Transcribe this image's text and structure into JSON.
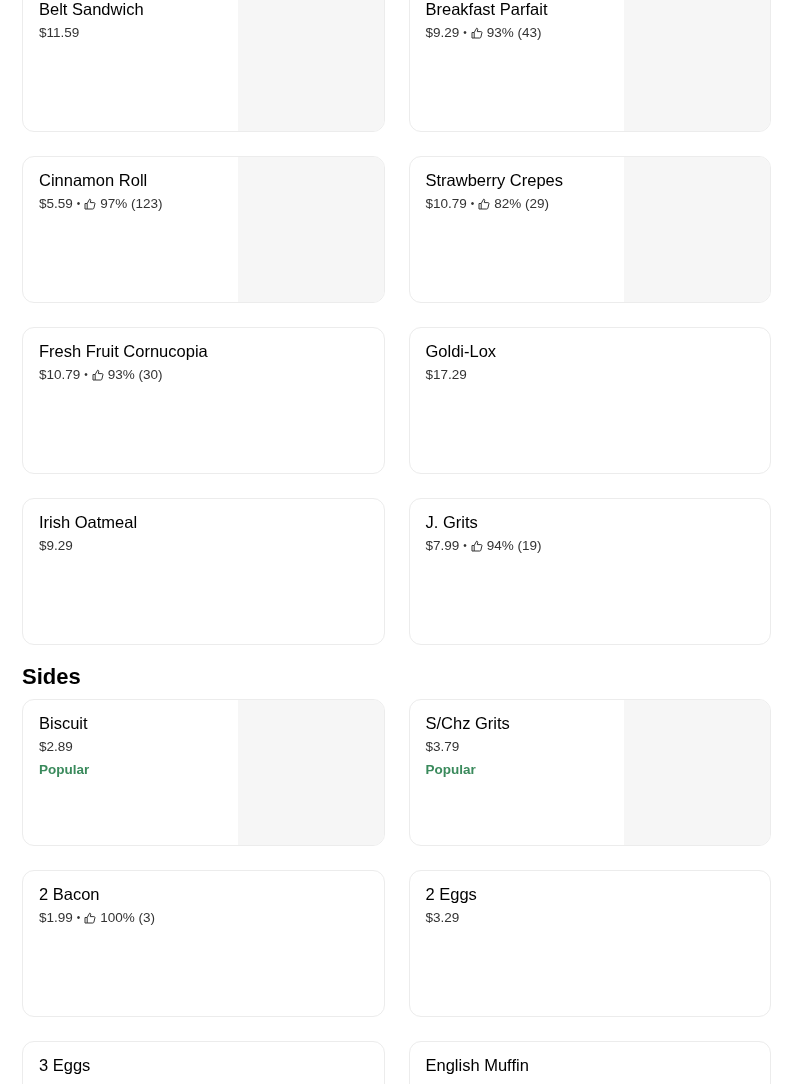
{
  "sections": [
    {
      "items": [
        {
          "name": "Belt Sandwich",
          "price": "$11.59",
          "has_image": true
        },
        {
          "name": "Breakfast Parfait",
          "price": "$9.29",
          "separator": "•",
          "rating": "93% (43)",
          "has_image": true
        },
        {
          "name": "Cinnamon Roll",
          "price": "$5.59",
          "separator": "•",
          "rating": "97% (123)",
          "has_image": true
        },
        {
          "name": "Strawberry Crepes",
          "price": "$10.79",
          "separator": "•",
          "rating": "82% (29)",
          "has_image": true
        },
        {
          "name": "Fresh Fruit Cornucopia",
          "price": "$10.79",
          "separator": "•",
          "rating": "93% (30)",
          "has_image": false
        },
        {
          "name": "Goldi-Lox",
          "price": "$17.29",
          "has_image": false
        },
        {
          "name": "Irish Oatmeal",
          "price": "$9.29",
          "has_image": false
        },
        {
          "name": "J. Grits",
          "price": "$7.99",
          "separator": "•",
          "rating": "94% (19)",
          "has_image": false
        }
      ]
    },
    {
      "title": "Sides",
      "items": [
        {
          "name": "Biscuit",
          "price": "$2.89",
          "tag": "Popular",
          "has_image": true
        },
        {
          "name": "S/Chz Grits",
          "price": "$3.79",
          "tag": "Popular",
          "has_image": true
        },
        {
          "name": "2 Bacon",
          "price": "$1.99",
          "separator": "•",
          "rating": "100% (3)",
          "has_image": false
        },
        {
          "name": "2 Eggs",
          "price": "$3.29",
          "has_image": false
        },
        {
          "name": "3 Eggs",
          "has_image": false
        },
        {
          "name": "English Muffin",
          "has_image": false
        }
      ]
    }
  ]
}
